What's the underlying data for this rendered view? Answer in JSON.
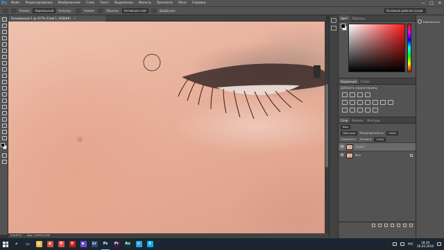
{
  "menubar": {
    "logo": "Ps",
    "items": [
      "Файл",
      "Редактирование",
      "Изображение",
      "Слои",
      "Текст",
      "Выделение",
      "Фильтр",
      "Просмотр",
      "Окно",
      "Справка"
    ],
    "controls": [
      "—",
      "□",
      "✕"
    ]
  },
  "options": {
    "mode_label": "Режим:",
    "mode_value": "Нормальный",
    "opacity_label": "Непрозр.:",
    "flow_label": "Нажим:",
    "sample_label": "Образец:",
    "sample_value": "Активный слой",
    "diffusion_label": "Диффузия:",
    "workspace": "Основная рабочая среда"
  },
  "document": {
    "tab_title": "Безымянный-1 @ 417% (Слой 1, RGB/8#)",
    "close": "×"
  },
  "status": {
    "zoom": "416,67%",
    "doc": "Док: 3,00М/3,00М"
  },
  "colors": {
    "tabs": [
      "Цвет",
      "Образцы"
    ],
    "accent_hue": "#ff1a1a"
  },
  "adjustments": {
    "tabs": [
      "Коррекция",
      "Стили"
    ],
    "title": "Добавить корректировку"
  },
  "layers": {
    "tabs": [
      "Слои",
      "Каналы",
      "Контуры"
    ],
    "kind_label": "Вид",
    "blend_mode": "Обычные",
    "opacity_label": "Непрозрачность:",
    "opacity_value": "100%",
    "lock_label": "Закрепить:",
    "fill_label": "Заливка:",
    "fill_value": "100%",
    "items": [
      {
        "name": "Слой 1",
        "selected": true
      },
      {
        "name": "Фон",
        "selected": false
      }
    ]
  },
  "libraries": {
    "label": "Библиотеки"
  },
  "taskbar": {
    "apps": [
      {
        "icon": "file-explorer-icon",
        "glyph": "▤",
        "color": "#e8b84a"
      },
      {
        "icon": "chrome-icon",
        "glyph": "◉",
        "color": "#dd4b39"
      },
      {
        "icon": "yandex-browser-icon",
        "glyph": "Я",
        "color": "#e84a3a"
      },
      {
        "icon": "opera-icon",
        "glyph": "O",
        "color": "#cc1b1b"
      },
      {
        "icon": "media-player-icon",
        "glyph": "▶",
        "color": "#6a4bd3"
      },
      {
        "icon": "lightroom-icon",
        "glyph": "Lr",
        "color": "#2b4a7a"
      },
      {
        "icon": "photoshop-icon",
        "glyph": "Ps",
        "color": "#0f2a45"
      },
      {
        "icon": "premiere-icon",
        "glyph": "Pr",
        "color": "#3a1b4a"
      },
      {
        "icon": "audition-icon",
        "glyph": "Au",
        "color": "#0b3a3a"
      },
      {
        "icon": "telegram-icon",
        "glyph": "✈",
        "color": "#2ca5e0"
      },
      {
        "icon": "skype-icon",
        "glyph": "S",
        "color": "#00aff0"
      }
    ],
    "lang": "РУС",
    "time": "18:19",
    "date": "26.02.2016"
  }
}
